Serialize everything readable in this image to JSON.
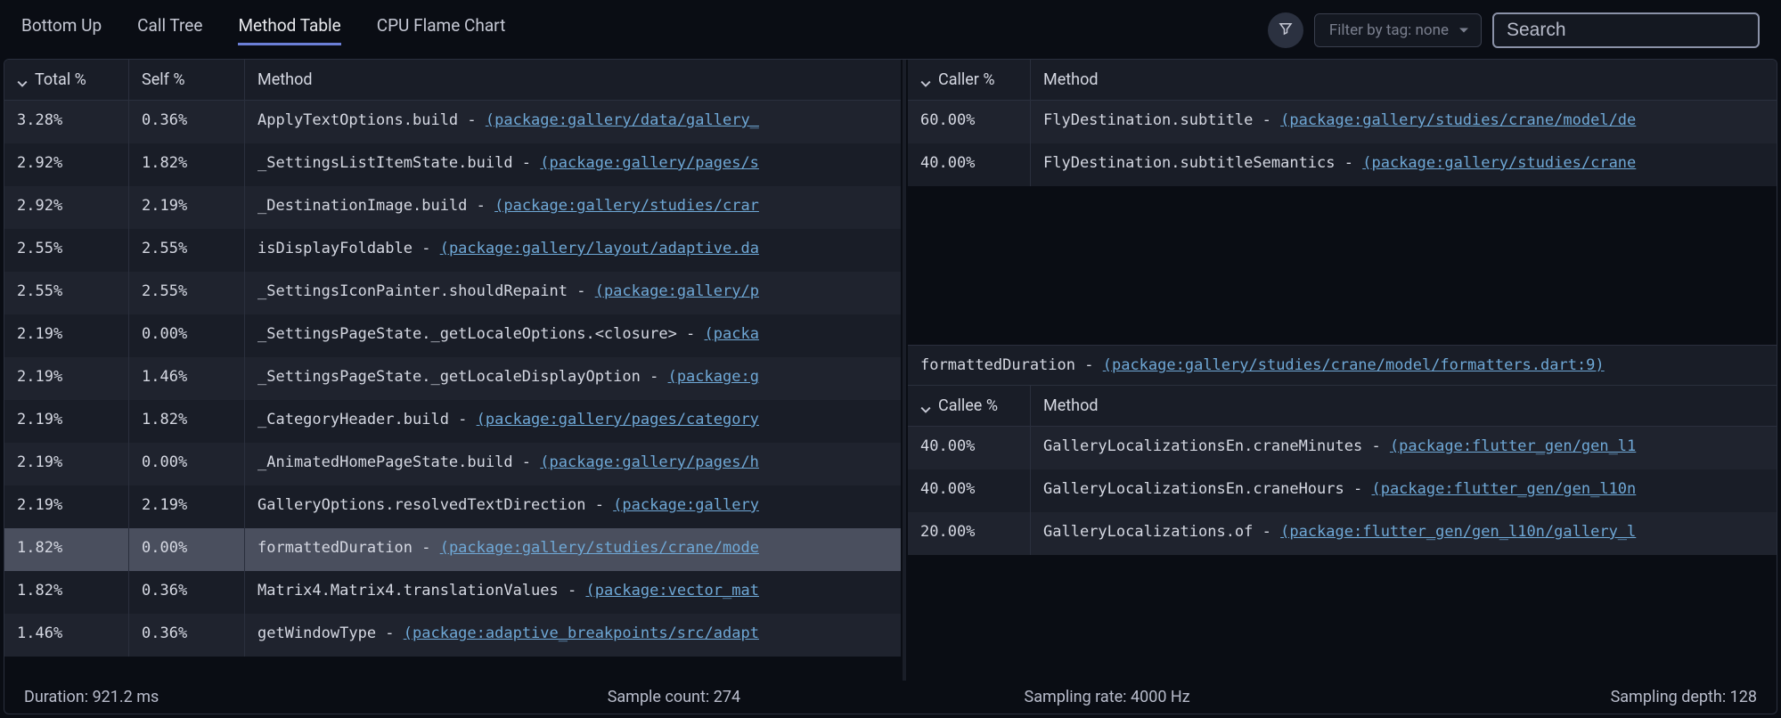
{
  "tabs": {
    "bottom_up": "Bottom Up",
    "call_tree": "Call Tree",
    "method_table": "Method Table",
    "flame": "CPU Flame Chart"
  },
  "active_tab": "method_table",
  "filter_tag_label": "Filter by tag: none",
  "search_placeholder": "Search",
  "left_table": {
    "headers": {
      "total": "Total %",
      "self": "Self %",
      "method": "Method"
    },
    "rows": [
      {
        "total": "3.28%",
        "self": "0.36%",
        "method": "ApplyTextOptions.build",
        "pkg": "(package:gallery/data/gallery_",
        "selected": false
      },
      {
        "total": "2.92%",
        "self": "1.82%",
        "method": "_SettingsListItemState.build",
        "pkg": "(package:gallery/pages/s",
        "selected": false
      },
      {
        "total": "2.92%",
        "self": "2.19%",
        "method": "_DestinationImage.build",
        "pkg": "(package:gallery/studies/crar",
        "selected": false
      },
      {
        "total": "2.55%",
        "self": "2.55%",
        "method": "isDisplayFoldable",
        "pkg": "(package:gallery/layout/adaptive.da",
        "selected": false
      },
      {
        "total": "2.55%",
        "self": "2.55%",
        "method": "_SettingsIconPainter.shouldRepaint",
        "pkg": "(package:gallery/p",
        "selected": false
      },
      {
        "total": "2.19%",
        "self": "0.00%",
        "method": "_SettingsPageState._getLocaleOptions.<closure>",
        "pkg": "(packa",
        "selected": false
      },
      {
        "total": "2.19%",
        "self": "1.46%",
        "method": "_SettingsPageState._getLocaleDisplayOption",
        "pkg": "(package:g",
        "selected": false
      },
      {
        "total": "2.19%",
        "self": "1.82%",
        "method": "_CategoryHeader.build",
        "pkg": "(package:gallery/pages/category",
        "selected": false
      },
      {
        "total": "2.19%",
        "self": "0.00%",
        "method": "_AnimatedHomePageState.build",
        "pkg": "(package:gallery/pages/h",
        "selected": false
      },
      {
        "total": "2.19%",
        "self": "2.19%",
        "method": "GalleryOptions.resolvedTextDirection",
        "pkg": "(package:gallery",
        "selected": false
      },
      {
        "total": "1.82%",
        "self": "0.00%",
        "method": "formattedDuration",
        "pkg": "(package:gallery/studies/crane/mode",
        "selected": true
      },
      {
        "total": "1.82%",
        "self": "0.36%",
        "method": "Matrix4.Matrix4.translationValues",
        "pkg": "(package:vector_mat",
        "selected": false
      },
      {
        "total": "1.46%",
        "self": "0.36%",
        "method": "getWindowType",
        "pkg": "(package:adaptive_breakpoints/src/adapt",
        "selected": false
      }
    ]
  },
  "caller_table": {
    "headers": {
      "pct": "Caller %",
      "method": "Method"
    },
    "rows": [
      {
        "pct": "60.00%",
        "method": "FlyDestination.subtitle",
        "pkg": "(package:gallery/studies/crane/model/de"
      },
      {
        "pct": "40.00%",
        "method": "FlyDestination.subtitleSemantics",
        "pkg": "(package:gallery/studies/crane"
      }
    ]
  },
  "selected_method": {
    "name": "formattedDuration",
    "pkg": "(package:gallery/studies/crane/model/formatters.dart:9)"
  },
  "callee_table": {
    "headers": {
      "pct": "Callee %",
      "method": "Method"
    },
    "rows": [
      {
        "pct": "40.00%",
        "method": "GalleryLocalizationsEn.craneMinutes",
        "pkg": "(package:flutter_gen/gen_l1"
      },
      {
        "pct": "40.00%",
        "method": "GalleryLocalizationsEn.craneHours",
        "pkg": "(package:flutter_gen/gen_l10n"
      },
      {
        "pct": "20.00%",
        "method": "GalleryLocalizations.of",
        "pkg": "(package:flutter_gen/gen_l10n/gallery_l"
      }
    ]
  },
  "status": {
    "duration": "Duration: 921.2 ms",
    "samples": "Sample count: 274",
    "rate": "Sampling rate: 4000 Hz",
    "depth": "Sampling depth: 128"
  }
}
